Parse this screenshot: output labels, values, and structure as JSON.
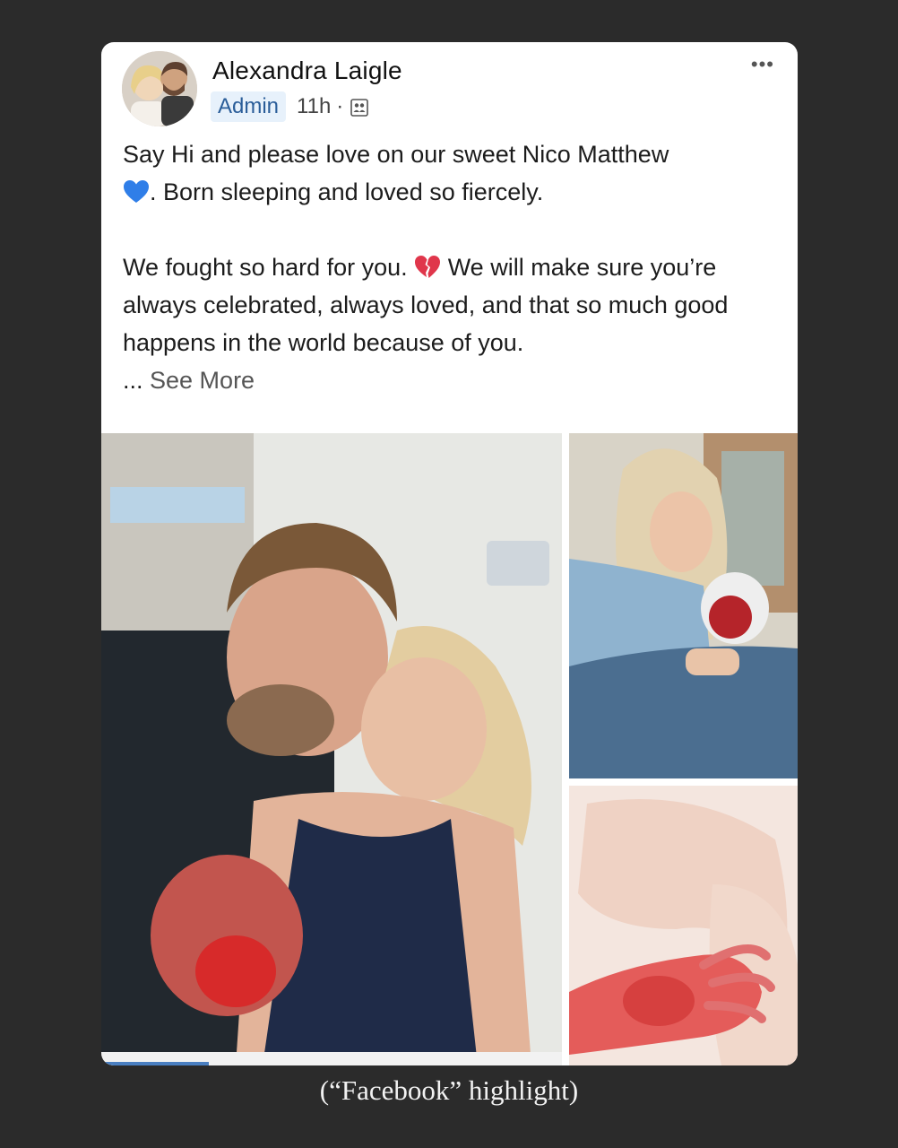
{
  "post": {
    "author": "Alexandra Laigle",
    "badge": "Admin",
    "time": "11h",
    "separator": "·",
    "more_label": "•••",
    "paragraph1_line1": "Say Hi and please love on our sweet Nico Matthew",
    "paragraph1_line2": ". Born sleeping and loved so fiercely.",
    "paragraph2_part1": "We fought so hard for you. ",
    "paragraph2_part2": " We will make sure you’re always celebrated, always loved, and that so much good happens in the world because of you.",
    "ellipsis": "... ",
    "see_more": "See More",
    "icons": {
      "heart": "blue-heart-icon",
      "broken_heart": "broken-heart-icon",
      "audience": "group-icon",
      "more": "more-dots-icon"
    },
    "colors": {
      "badge_bg": "#e7f1fb",
      "badge_text": "#2a5d99",
      "blue_heart": "#2f7ee8",
      "broken_heart": "#e0364b"
    }
  },
  "photos": [
    {
      "name": "couple-with-baby"
    },
    {
      "name": "mother-holding-baby"
    },
    {
      "name": "baby-hand"
    }
  ],
  "caption": "(“Facebook” highlight)"
}
